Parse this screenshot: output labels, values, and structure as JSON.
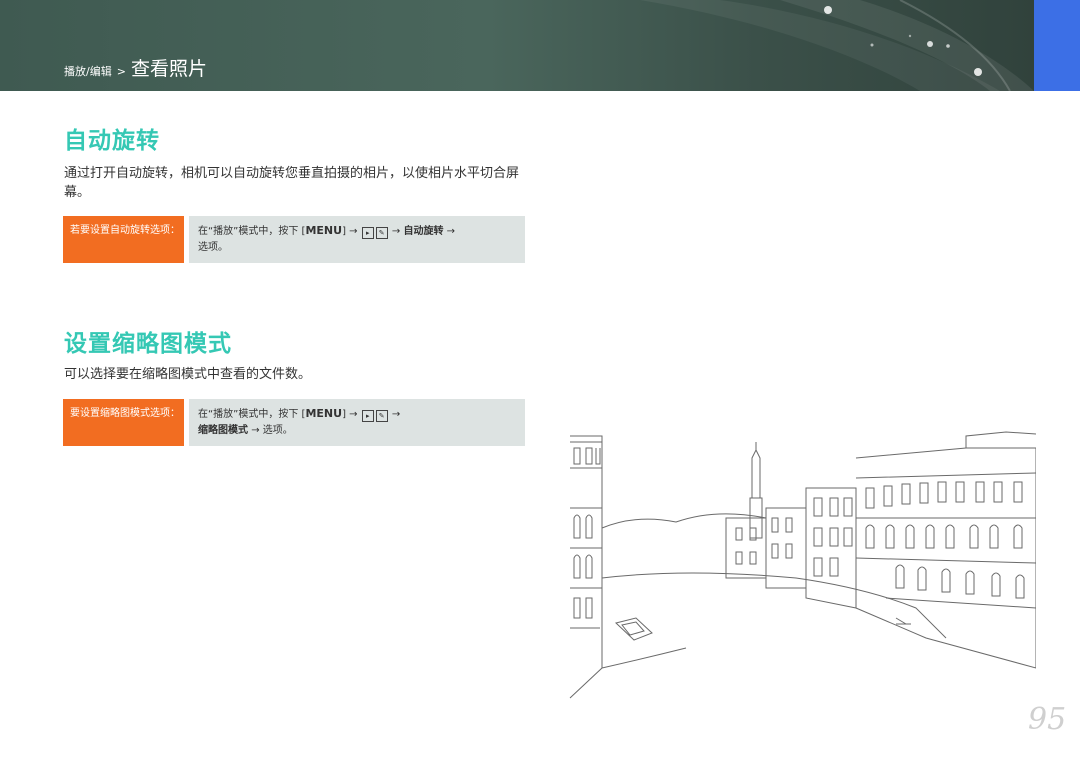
{
  "header": {
    "section": "播放/编辑",
    "separator": ">",
    "page_title": "查看照片"
  },
  "sections": [
    {
      "heading": "自动旋转",
      "paragraph": "通过打开自动旋转，相机可以自动旋转您垂直拍摄的相片，以使相片水平切合屏幕。",
      "tip": {
        "label": "若要设置自动旋转选项：",
        "body_prefix": "在“播放”模式中，按下 [",
        "menu_key": "MENU",
        "body_mid": "] →",
        "icon_play": "▸",
        "icon_edit": "✎",
        "arrow": "→",
        "bold_item": "自动旋转",
        "arrow2": "→",
        "body_suffix": "选项。"
      }
    },
    {
      "heading": "设置缩略图模式",
      "paragraph": "可以选择要在缩略图模式中查看的文件数。",
      "tip": {
        "label": "要设置缩略图模式选项：",
        "body_prefix": "在“播放”模式中，按下 [",
        "menu_key": "MENU",
        "body_mid": "] →",
        "icon_play": "▸",
        "icon_edit": "✎",
        "arrow": "→",
        "bold_item": "缩略图模式",
        "arrow2": "→",
        "body_suffix": "选项。"
      }
    }
  ],
  "page_number": "95",
  "colors": {
    "header_bg": "#45625a",
    "accent_tab": "#3c6fe6",
    "heading": "#35c8b4",
    "tip_label": "#f26d21",
    "tip_body": "#dde3e2"
  },
  "icons": [
    "play-mode-icon",
    "edit-icon"
  ]
}
